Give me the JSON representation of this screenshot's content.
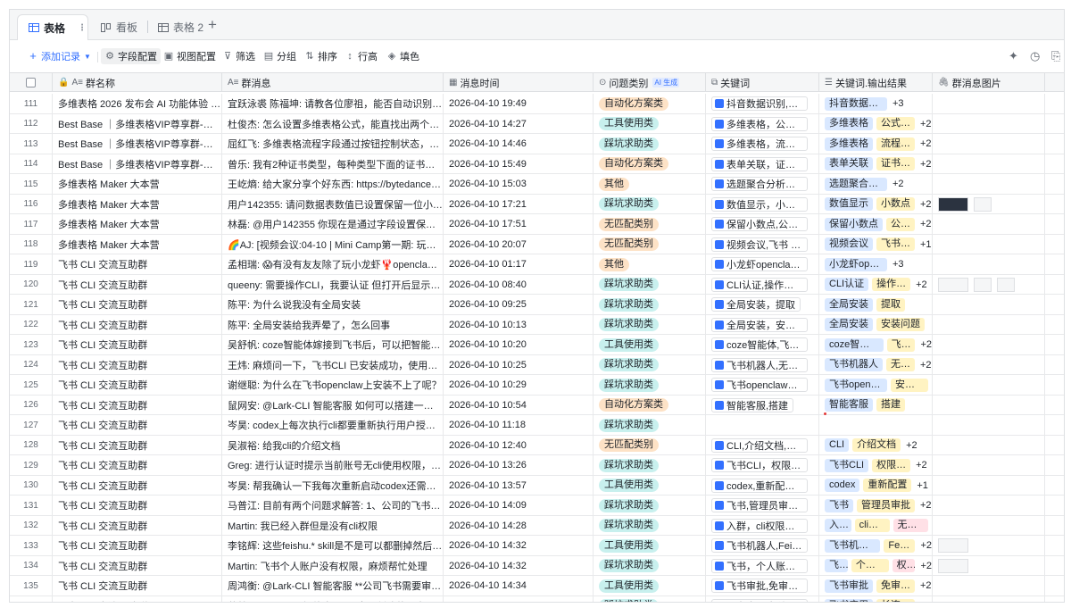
{
  "tabs": [
    {
      "label": "表格",
      "active": true
    },
    {
      "label": "看板",
      "active": false
    },
    {
      "label": "表格 2",
      "active": false
    }
  ],
  "toolbar": {
    "add_record": "添加记录",
    "field_config": "字段配置",
    "view_config": "视图配置",
    "filter": "筛选",
    "group": "分组",
    "sort": "排序",
    "row_height": "行高",
    "fill": "填色"
  },
  "columns": [
    {
      "label": "群名称",
      "icon": "text-field-icon"
    },
    {
      "label": "群消息",
      "icon": "text-field-icon"
    },
    {
      "label": "消息时间",
      "icon": "date-field-icon"
    },
    {
      "label": "问题类别",
      "icon": "single-select-icon",
      "badge": "AI 生成"
    },
    {
      "label": "关键词",
      "icon": "lookup-icon"
    },
    {
      "label": "关键词.输出结果",
      "icon": "multi-select-icon"
    },
    {
      "label": "群消息图片",
      "icon": "attachment-icon"
    }
  ],
  "category_colors": {
    "自动化方案类": "#fde2c6",
    "工具使用类": "#c8f0ee",
    "踩坑求助类": "#c8f0ee",
    "其他": "#fde2c6",
    "无匹配类别": "#fde2c6"
  },
  "rows": [
    {
      "n": "111",
      "group": "多维表格 2026 发布会 AI 功能体验 1 群",
      "msg": "宜跃泳裘 陈福坤: 请教各位廖祖，能否自动识别抖音…",
      "time": "2026-04-10 19:49",
      "cat": "自动化方案类",
      "kw": "抖音数据识别,自动…",
      "out": [
        "抖音数据识别"
      ],
      "more": "+3",
      "img": 0
    },
    {
      "n": "112",
      "group": "Best Base ｜多维表格VIP尊享群-年度十…",
      "msg": "杜俊杰: 怎么设置多维表格公式，能直找出两个多选…",
      "time": "2026-04-10 14:27",
      "cat": "工具使用类",
      "kw": "多维表格，公式设…",
      "out": [
        "多维表格",
        "公式…"
      ],
      "more": "+2",
      "img": 0
    },
    {
      "n": "113",
      "group": "Best Base ｜多维表格VIP尊享群-年度十…",
      "msg": "屈红飞: 多维表格流程字段通过按钮控制状态，但是…",
      "time": "2026-04-10 14:46",
      "cat": "踩坑求助类",
      "kw": "多维表格，流程字段…",
      "out": [
        "多维表格",
        "流程…"
      ],
      "more": "+2",
      "img": 0
    },
    {
      "n": "114",
      "group": "Best Base ｜多维表格VIP尊享群-年度十…",
      "msg": "曾乐: 我有2种证书类型，每种类型下面的证书有百…",
      "time": "2026-04-10 15:49",
      "cat": "自动化方案类",
      "kw": "表单关联，证书筛…",
      "out": [
        "表单关联",
        "证书…"
      ],
      "more": "+2",
      "img": 0
    },
    {
      "n": "115",
      "group": "多维表格 Maker 大本营",
      "msg": "王屹熵: 给大家分享个好东西: https://bytedance.lar…",
      "time": "2026-04-10 15:03",
      "cat": "其他",
      "kw": "选题聚合分析，skil…",
      "out": [
        "选题聚合分析"
      ],
      "more": "+2",
      "img": 0
    },
    {
      "n": "116",
      "group": "多维表格 Maker 大本营",
      "msg": "用户142355: 请问数据表数值已设置保留一位小数…",
      "time": "2026-04-10 17:21",
      "cat": "踩坑求助类",
      "kw": "数值显示，小数点…",
      "out": [
        "数值显示",
        "小数点"
      ],
      "more": "+2",
      "img": 2
    },
    {
      "n": "117",
      "group": "多维表格 Maker 大本营",
      "msg": "林磊: @用户142355 你现在是通过字段设置保留小…",
      "time": "2026-04-10 17:51",
      "cat": "无匹配类别",
      "kw": "保留小数点,公式提…",
      "out": [
        "保留小数点",
        "公…"
      ],
      "more": "+2",
      "img": 0
    },
    {
      "n": "118",
      "group": "多维表格 Maker 大本营",
      "msg": "🌈AJ: [视频会议:04-10 | Mini Camp第一期: 玩转飞…",
      "time": "2026-04-10 20:07",
      "cat": "无匹配类别",
      "kw": "视频会议,飞书 CLI,…",
      "out": [
        "视频会议",
        "飞书…"
      ],
      "more": "+1",
      "img": 0
    },
    {
      "n": "119",
      "group": "飞书 CLI 交流互助群",
      "msg": "孟相瑞: 😱有没有友友除了玩小龙虾🦞openclaw之…",
      "time": "2026-04-10 01:17",
      "cat": "其他",
      "kw": "小龙虾openclaw, h…",
      "out": [
        "小龙虾openclaw"
      ],
      "more": "+3",
      "img": 0
    },
    {
      "n": "120",
      "group": "飞书 CLI 交流互助群",
      "msg": "queeny: 需要操作CLI，我要认证 但打开后显示错误…",
      "time": "2026-04-10 08:40",
      "cat": "踩坑求助类",
      "kw": "CLI认证,操作错误,…",
      "out": [
        "CLI认证",
        "操作…"
      ],
      "more": "+2",
      "img": 3
    },
    {
      "n": "121",
      "group": "飞书 CLI 交流互助群",
      "msg": "陈平: 为什么说我没有全局安装",
      "time": "2026-04-10 09:25",
      "cat": "踩坑求助类",
      "kw": "全局安装，提取",
      "out": [
        "全局安装",
        "提取"
      ],
      "more": "",
      "img": 0
    },
    {
      "n": "122",
      "group": "飞书 CLI 交流互助群",
      "msg": "陈平: 全局安装给我弄晕了，怎么回事",
      "time": "2026-04-10 10:13",
      "cat": "踩坑求助类",
      "kw": "全局安装，安装问题",
      "out": [
        "全局安装",
        "安装问题"
      ],
      "more": "",
      "img": 0
    },
    {
      "n": "123",
      "group": "飞书 CLI 交流互助群",
      "msg": "吴舒帆: coze智能体嫁接到飞书后，可以把智能体输…",
      "time": "2026-04-10 10:20",
      "cat": "工具使用类",
      "kw": "coze智能体,飞书,…",
      "out": [
        "coze智能体",
        "飞书"
      ],
      "more": "+2",
      "img": 0
    },
    {
      "n": "124",
      "group": "飞书 CLI 交流互助群",
      "msg": "王炜: 麻烦问一下，飞书CLI 已安装成功，使用Open…",
      "time": "2026-04-10 10:25",
      "cat": "踩坑求助类",
      "kw": "飞书机器人,无反应…",
      "out": [
        "飞书机器人",
        "无…"
      ],
      "more": "+2",
      "img": 0
    },
    {
      "n": "125",
      "group": "飞书 CLI 交流互助群",
      "msg": "谢继聪: 为什么在飞书openclaw上安装不上了呢？",
      "time": "2026-04-10 10:29",
      "cat": "踩坑求助类",
      "kw": "飞书openclaw，安…",
      "out": [
        "飞书openclaw",
        "安装…"
      ],
      "more": "",
      "img": 0
    },
    {
      "n": "126",
      "group": "飞书 CLI 交流互助群",
      "msg": "鼠网安: @Lark-CLI 智能客服 如何可以搭建一个和你…",
      "time": "2026-04-10 10:54",
      "cat": "自动化方案类",
      "kw": "智能客服,搭建",
      "out": [
        "智能客服",
        "搭建"
      ],
      "more": "",
      "img": 0
    },
    {
      "n": "127",
      "group": "飞书 CLI 交流互助群",
      "msg": "岑昊: codex上每次执行cli都要重新执行用户授权吗…",
      "time": "2026-04-10 11:18",
      "cat": "踩坑求助类",
      "kw": "",
      "out": [],
      "more": "",
      "img": 0
    },
    {
      "n": "128",
      "group": "飞书 CLI 交流互助群",
      "msg": "吴淑裕: 给我cli的介绍文档",
      "time": "2026-04-10 12:40",
      "cat": "无匹配类别",
      "kw": "CLI,介绍文档,关键…",
      "out": [
        "CLI",
        "介绍文档"
      ],
      "more": "+2",
      "img": 0
    },
    {
      "n": "129",
      "group": "飞书 CLI 交流互助群",
      "msg": "Greg: 进行认证时提示当前账号无cli使用权限，可功…",
      "time": "2026-04-10 13:26",
      "cat": "踩坑求助类",
      "kw": "飞书CLI，权限错…",
      "out": [
        "飞书CLI",
        "权限…"
      ],
      "more": "+2",
      "img": 0
    },
    {
      "n": "130",
      "group": "飞书 CLI 交流互助群",
      "msg": "岑昊: 帮我确认一下我每次重新启动codex还需要重…",
      "time": "2026-04-10 13:57",
      "cat": "工具使用类",
      "kw": "codex,重新配置,本…",
      "out": [
        "codex",
        "重新配置"
      ],
      "more": "+1",
      "img": 0
    },
    {
      "n": "131",
      "group": "飞书 CLI 交流互助群",
      "msg": "马普江: 目前有两个问题求解答:  1、公司的飞书需…",
      "time": "2026-04-10 14:09",
      "cat": "踩坑求助类",
      "kw": "飞书,管理员审批,…",
      "out": [
        "飞书",
        "管理员审批"
      ],
      "more": "+2",
      "img": 0
    },
    {
      "n": "132",
      "group": "飞书 CLI 交流互助群",
      "msg": "Martin: 我已经入群但是没有cli权限",
      "time": "2026-04-10 14:28",
      "cat": "踩坑求助类",
      "kw": "入群，cli权限，无…",
      "out": [
        "入群",
        "cli权限",
        "无权限"
      ],
      "more": "",
      "img": 0
    },
    {
      "n": "133",
      "group": "飞书 CLI 交流互助群",
      "msg": "李铭辉: 这些feishu.* skill是不是可以都删掉然后重新…",
      "time": "2026-04-10 14:32",
      "cat": "工具使用类",
      "kw": "飞书机器人,Feishu…",
      "out": [
        "飞书机器人",
        "Fei…"
      ],
      "more": "+2",
      "img": 1
    },
    {
      "n": "134",
      "group": "飞书 CLI 交流互助群",
      "msg": "Martin: 飞书个人账户没有权限，麻烦帮忙处理",
      "time": "2026-04-10 14:32",
      "cat": "踩坑求助类",
      "kw": "飞书，个人账户，…",
      "out": [
        "飞书",
        "个人账户",
        "权…"
      ],
      "more": "+2",
      "img": 1
    },
    {
      "n": "135",
      "group": "飞书 CLI 交流互助群",
      "msg": "周鸿衡: @Lark-CLI 智能客服 **公司飞书需要审批，…",
      "time": "2026-04-10 14:34",
      "cat": "工具使用类",
      "kw": "飞书审批,免审批权…",
      "out": [
        "飞书审批",
        "免审…"
      ],
      "more": "+2",
      "img": 0
    },
    {
      "n": "136",
      "group": "飞书 CLI 交流互助群",
      "msg": "蔡慧: @Lark-CLI 智能客服 cli 自动创建的飞书应用…",
      "time": "2026-04-10 14:36",
      "cat": "踩坑求助类",
      "kw": "飞书应用,长连接验…",
      "out": [
        "飞书应用",
        "长连…"
      ],
      "more": "+2",
      "img": 0
    }
  ]
}
